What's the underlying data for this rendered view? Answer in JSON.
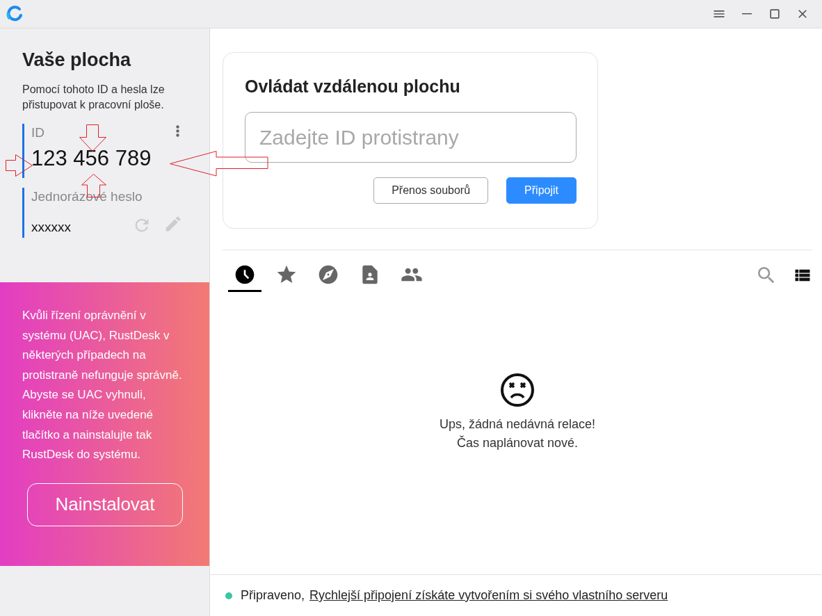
{
  "sidebar": {
    "title": "Vaše plocha",
    "description": "Pomocí tohoto ID a hesla lze přistupovat k pracovní ploše.",
    "id_label": "ID",
    "id_value": "123 456 789",
    "password_label": "Jednorázové heslo",
    "password_value": "xxxxxx"
  },
  "install_banner": {
    "message": "Kvůli řízení oprávnění v systému (UAC), RustDesk v některých případech na protistraně nefunguje správně. Abyste se UAC vyhnuli, klikněte na níže uvedené tlačítko a nainstalujte tak RustDesk do systému.",
    "button": "Nainstalovat"
  },
  "connect_card": {
    "title": "Ovládat vzdálenou plochu",
    "placeholder": "Zadejte ID protistrany",
    "buttons": [
      {
        "label": "Přenos souborů",
        "kind": "outline"
      },
      {
        "label": "Připojit",
        "kind": "primary"
      }
    ]
  },
  "tabs": [
    {
      "kind": "recent",
      "selected": true
    },
    {
      "kind": "favorites",
      "selected": false
    },
    {
      "kind": "discovered",
      "selected": false
    },
    {
      "kind": "address_book",
      "selected": false
    },
    {
      "kind": "group",
      "selected": false
    }
  ],
  "empty_state": {
    "lines": [
      "Ups, žádná nedávná relace!",
      "Čas naplánovat nové."
    ]
  },
  "status_bar": {
    "color": "#3ec4a4",
    "status": "Připraveno,",
    "link": "Rychlejší připojení získáte vytvořením si svého vlastního serveru"
  }
}
